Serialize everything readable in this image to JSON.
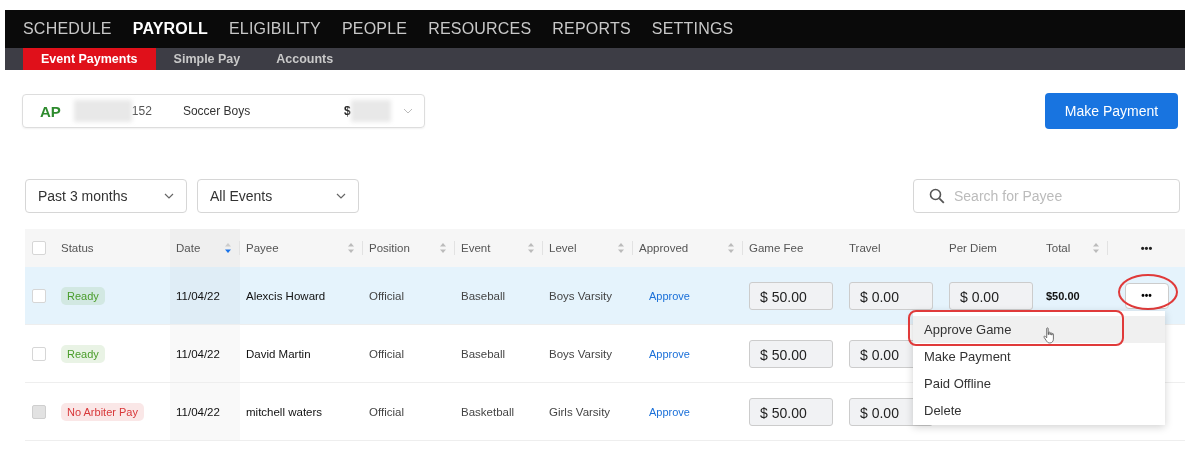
{
  "nav": {
    "items": [
      {
        "label": "SCHEDULE",
        "selected": false
      },
      {
        "label": "PAYROLL",
        "selected": true
      },
      {
        "label": "ELIGIBILITY",
        "selected": false
      },
      {
        "label": "PEOPLE",
        "selected": false
      },
      {
        "label": "RESOURCES",
        "selected": false
      },
      {
        "label": "REPORTS",
        "selected": false
      },
      {
        "label": "SETTINGS",
        "selected": false
      }
    ]
  },
  "subnav": {
    "items": [
      {
        "label": "Event Payments",
        "selected": true
      },
      {
        "label": "Simple Pay",
        "selected": false
      },
      {
        "label": "Accounts",
        "selected": false
      }
    ]
  },
  "account": {
    "code": "AP",
    "number": "152",
    "name": "Soccer Boys",
    "amount": "$"
  },
  "make_payment_button": "Make Payment",
  "filters": [
    {
      "value": "Past 3 months"
    },
    {
      "value": "All Events"
    }
  ],
  "search": {
    "placeholder": "Search for Payee"
  },
  "table": {
    "select_all": {
      "checked": false
    },
    "columns": [
      {
        "label": "Status",
        "sortable": false
      },
      {
        "label": "Date",
        "sortable": true,
        "sorted": true
      },
      {
        "label": "Payee",
        "sortable": true,
        "sorted": false
      },
      {
        "label": "Position",
        "sortable": true,
        "sorted": false
      },
      {
        "label": "Event",
        "sortable": true,
        "sorted": false
      },
      {
        "label": "Level",
        "sortable": true,
        "sorted": false
      },
      {
        "label": "Approved",
        "sortable": true,
        "sorted": false
      },
      {
        "label": "Game Fee",
        "sortable": false
      },
      {
        "label": "Travel",
        "sortable": false
      },
      {
        "label": "Per Diem",
        "sortable": false
      },
      {
        "label": "Total",
        "sortable": true,
        "sorted": false
      },
      {
        "label": "•••"
      }
    ],
    "rows": [
      {
        "selected": true,
        "checked": false,
        "disabled": false,
        "status": "Ready",
        "color": "#4a9d2a",
        "date": "11/04/22",
        "payee": "Alexcis Howard",
        "position": "Official",
        "event": "Baseball",
        "level": "Boys Varsity",
        "approved": "Approve",
        "game_fee": "$ 50.00",
        "travel": "$ 0.00",
        "per_diem": "$ 0.00",
        "total": "$50.00",
        "action": "•••",
        "action_circled": true
      },
      {
        "selected": false,
        "checked": false,
        "disabled": false,
        "status": "Ready",
        "color": "#4a9d2a",
        "date": "11/04/22",
        "payee": "David Martin",
        "position": "Official",
        "event": "Baseball",
        "level": "Boys Varsity",
        "approved": "Approve",
        "game_fee": "$ 50.00",
        "travel": "$ 0.00"
      },
      {
        "selected": false,
        "checked": false,
        "disabled": true,
        "status": "No Arbiter Pay",
        "color": "#d8383a",
        "date": "11/04/22",
        "payee": "mitchell waters",
        "position": "Official",
        "event": "Basketball",
        "level": "Girls Varsity",
        "approved": "Approve",
        "game_fee": "$ 50.00",
        "travel": "$ 0.00"
      }
    ]
  },
  "row_menu": {
    "items": [
      {
        "label": "Approve Game",
        "highlighted": true
      },
      {
        "label": "Make Payment",
        "highlighted": false
      },
      {
        "label": "Paid Offline",
        "highlighted": false
      },
      {
        "label": "Delete",
        "highlighted": false
      }
    ]
  }
}
